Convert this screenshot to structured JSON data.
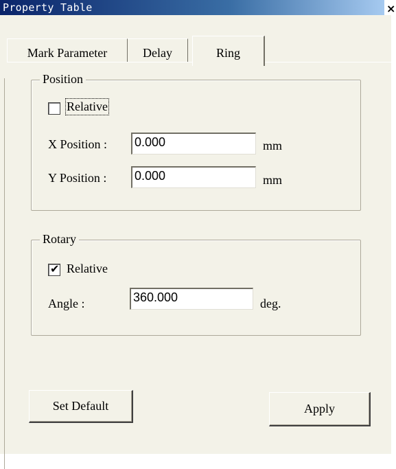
{
  "window": {
    "title": "Property Table",
    "close_glyph": "×"
  },
  "tabs": [
    {
      "label": "Mark Parameter",
      "active": false
    },
    {
      "label": "Delay",
      "active": false
    },
    {
      "label": "Ring",
      "active": true
    }
  ],
  "position_group": {
    "legend": "Position",
    "relative_label": "Relative",
    "relative_checked": false,
    "x_label": "X Position :",
    "x_value": "0.000",
    "x_unit": "mm",
    "y_label": "Y Position :",
    "y_value": "0.000",
    "y_unit": "mm"
  },
  "rotary_group": {
    "legend": "Rotary",
    "relative_label": "Relative",
    "relative_checked": true,
    "checkmark_glyph": "✔",
    "angle_label": "Angle :",
    "angle_value": "360.000",
    "angle_unit": "deg."
  },
  "buttons": {
    "set_default": "Set Default",
    "apply": "Apply"
  },
  "colors": {
    "title_bar": "#0a246a",
    "panel": "#f3f2e8"
  }
}
